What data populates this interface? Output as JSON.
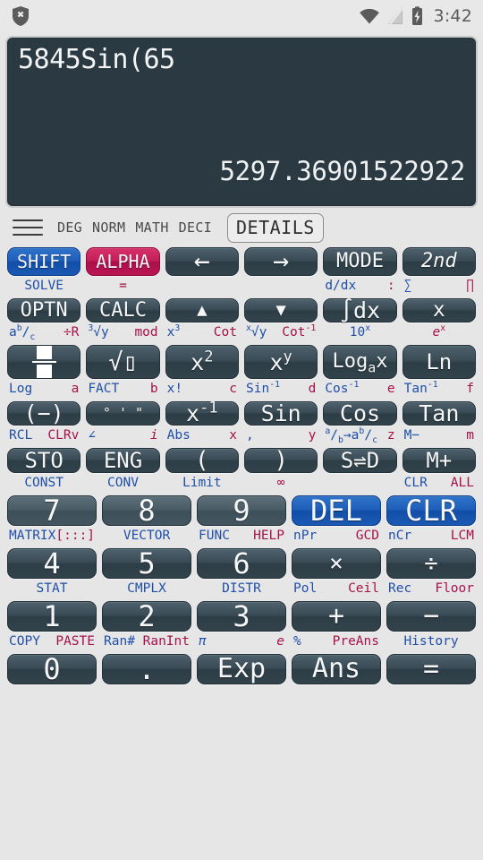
{
  "statusbar": {
    "time": "3:42",
    "icons": [
      "shield-x-icon",
      "wifi-icon",
      "signal-off-icon",
      "battery-charging-icon"
    ]
  },
  "display": {
    "expression": "5845Sin(65",
    "result": "5297.36901522922"
  },
  "modebar": {
    "menu": "hamburger-menu",
    "flags": [
      "DEG",
      "NORM",
      "MATH",
      "DECI"
    ],
    "details_label": "DETAILS"
  },
  "accent": {
    "blue": "#1f4fa8",
    "crimson": "#a6124a",
    "key": "#3a4b55",
    "display_bg": "#2b3a42"
  },
  "keypad": {
    "rows": [
      {
        "keys": [
          {
            "label": "SHIFT",
            "style": "blue",
            "size": 20,
            "sub_a": "SOLVE",
            "sub_b": ""
          },
          {
            "label": "ALPHA",
            "style": "crimson",
            "size": 20,
            "sub_a": "",
            "sub_b": "="
          },
          {
            "label": "←",
            "style": "dark",
            "size": 30,
            "sub_a": "",
            "sub_b": ""
          },
          {
            "label": "→",
            "style": "dark",
            "size": 30,
            "sub_a": "",
            "sub_b": ""
          },
          {
            "label": "MODE",
            "style": "dark",
            "size": 22,
            "sub_a": "d/dx",
            "sub_b": ":"
          },
          {
            "label": "2nd",
            "style": "dark",
            "size": 22,
            "italic": true,
            "sub_a": "∑",
            "sub_b": "∏"
          }
        ]
      },
      {
        "keys": [
          {
            "label": "OPTN",
            "style": "dark",
            "size": 22,
            "sub_a": "a<sup>b</sup>/<sub>c</sub>",
            "sub_b": "÷R"
          },
          {
            "label": "CALC",
            "style": "dark",
            "size": 22,
            "sub_a": "<sup>3</sup>√y",
            "sub_b": "mod"
          },
          {
            "label": "▲",
            "style": "dark",
            "size": 19,
            "sub_a": "x<sup>3</sup>",
            "sub_b": "Cot"
          },
          {
            "label": "▼",
            "style": "dark",
            "size": 19,
            "sub_a": "<sup>x</sup>√y",
            "sub_b": "Cot<sup>-1</sup>"
          },
          {
            "label": "∫dx",
            "style": "dark",
            "size": 25,
            "sub_a": "10<sup>x</sup>",
            "sub_b": ""
          },
          {
            "label": "x",
            "style": "dark",
            "size": 23,
            "sub_a": "",
            "sub_b": "<i>e</i><sup>x</sup>"
          }
        ]
      },
      {
        "keys": [
          {
            "label": "FRACTION-ICON",
            "icon": "fraction-icon",
            "style": "dark",
            "size": 22,
            "sub_a": "Log",
            "sub_b": "a"
          },
          {
            "label": "√▯",
            "style": "dark",
            "size": 27,
            "sub_a": "FACT",
            "sub_b": "b"
          },
          {
            "label": "x<sup>2</sup>",
            "style": "dark",
            "size": 25,
            "sub_a": "x!",
            "sub_b": "c"
          },
          {
            "label": "x<sup>y</sup>",
            "style": "dark",
            "size": 25,
            "sub_a": "Sin<sup>-1</sup>",
            "sub_b": "d"
          },
          {
            "label": "Log<sub>a</sub>x",
            "style": "dark",
            "size": 22,
            "sub_a": "Cos<sup>-1</sup>",
            "sub_b": "e"
          },
          {
            "label": "Ln",
            "style": "dark",
            "size": 24,
            "sub_a": "Tan<sup>-1</sup>",
            "sub_b": "f"
          }
        ]
      },
      {
        "keys": [
          {
            "label": "(−)",
            "style": "dark",
            "size": 25,
            "sub_a": "RCL",
            "sub_b": "CLRv"
          },
          {
            "label": "° ' \"",
            "style": "dark",
            "size": 15,
            "sub_a": "∠",
            "sub_b": "<i>i</i>"
          },
          {
            "label": "x<sup>-1</sup>",
            "style": "dark",
            "size": 25,
            "sub_a": "Abs",
            "sub_b": "x"
          },
          {
            "label": "Sin",
            "style": "dark",
            "size": 25,
            "sub_a": ",",
            "sub_b": "y"
          },
          {
            "label": "Cos",
            "style": "dark",
            "size": 25,
            "sub_a": "<sup>a</sup>/<sub>b</sub>→a<sup>b</sup>/<sub>c</sub>",
            "sub_b": "z"
          },
          {
            "label": "Tan",
            "style": "dark",
            "size": 25,
            "sub_a": "M−",
            "sub_b": "m"
          }
        ]
      },
      {
        "keys": [
          {
            "label": "STO",
            "style": "dark",
            "size": 24,
            "sub_a": "CONST",
            "sub_b": ""
          },
          {
            "label": "ENG",
            "style": "dark",
            "size": 24,
            "sub_a": "CONV",
            "sub_b": ""
          },
          {
            "label": "(",
            "style": "dark",
            "size": 26,
            "sub_a": "Limit",
            "sub_b": ""
          },
          {
            "label": ")",
            "style": "dark",
            "size": 26,
            "sub_a": "",
            "sub_b": "∞"
          },
          {
            "label": "S⇌D",
            "style": "dark",
            "size": 24,
            "sub_a": "",
            "sub_b": ""
          },
          {
            "label": "M+",
            "style": "dark",
            "size": 24,
            "sub_a": "CLR",
            "sub_b": "ALL"
          }
        ]
      },
      {
        "keys": [
          {
            "label": "7",
            "style": "gray",
            "size": 32,
            "sub_a": "MATRIX",
            "sub_b": "[:::]"
          },
          {
            "label": "8",
            "style": "gray",
            "size": 32,
            "sub_a": "VECTOR",
            "sub_b": ""
          },
          {
            "label": "9",
            "style": "gray",
            "size": 32,
            "sub_a": "FUNC",
            "sub_b": "HELP"
          },
          {
            "label": "DEL",
            "style": "blue",
            "size": 32,
            "sub_a": "nPr",
            "sub_b": "GCD"
          },
          {
            "label": "CLR",
            "style": "blue",
            "size": 32,
            "sub_a": "nCr",
            "sub_b": "LCM"
          }
        ]
      },
      {
        "keys": [
          {
            "label": "4",
            "style": "dark",
            "size": 32,
            "sub_a": "STAT",
            "sub_b": ""
          },
          {
            "label": "5",
            "style": "dark",
            "size": 32,
            "sub_a": "CMPLX",
            "sub_b": ""
          },
          {
            "label": "6",
            "style": "dark",
            "size": 32,
            "sub_a": "DISTR",
            "sub_b": ""
          },
          {
            "label": "×",
            "style": "dark",
            "size": 26,
            "sub_a": "Pol",
            "sub_b": "Ceil"
          },
          {
            "label": "÷",
            "style": "dark",
            "size": 26,
            "sub_a": "Rec",
            "sub_b": "Floor"
          }
        ]
      },
      {
        "keys": [
          {
            "label": "1",
            "style": "dark",
            "size": 32,
            "sub_a": "COPY",
            "sub_b": "PASTE"
          },
          {
            "label": "2",
            "style": "dark",
            "size": 32,
            "sub_a": "Ran#",
            "sub_b": "RanInt"
          },
          {
            "label": "3",
            "style": "dark",
            "size": 32,
            "sub_a": "<i>π</i>",
            "sub_b": "<i>e</i>"
          },
          {
            "label": "+",
            "style": "dark",
            "size": 30,
            "sub_a": "%",
            "sub_b": "PreAns"
          },
          {
            "label": "−",
            "style": "dark",
            "size": 30,
            "sub_a": "History",
            "sub_b": ""
          }
        ]
      },
      {
        "keys": [
          {
            "label": "0",
            "style": "dark",
            "size": 32,
            "sub_a": "",
            "sub_b": ""
          },
          {
            "label": ".",
            "style": "dark",
            "size": 32,
            "sub_a": "",
            "sub_b": ""
          },
          {
            "label": "Exp",
            "style": "dark",
            "size": 30,
            "sub_a": "",
            "sub_b": ""
          },
          {
            "label": "Ans",
            "style": "dark",
            "size": 30,
            "sub_a": "",
            "sub_b": ""
          },
          {
            "label": "=",
            "style": "dark",
            "size": 30,
            "sub_a": "",
            "sub_b": ""
          }
        ]
      }
    ]
  }
}
